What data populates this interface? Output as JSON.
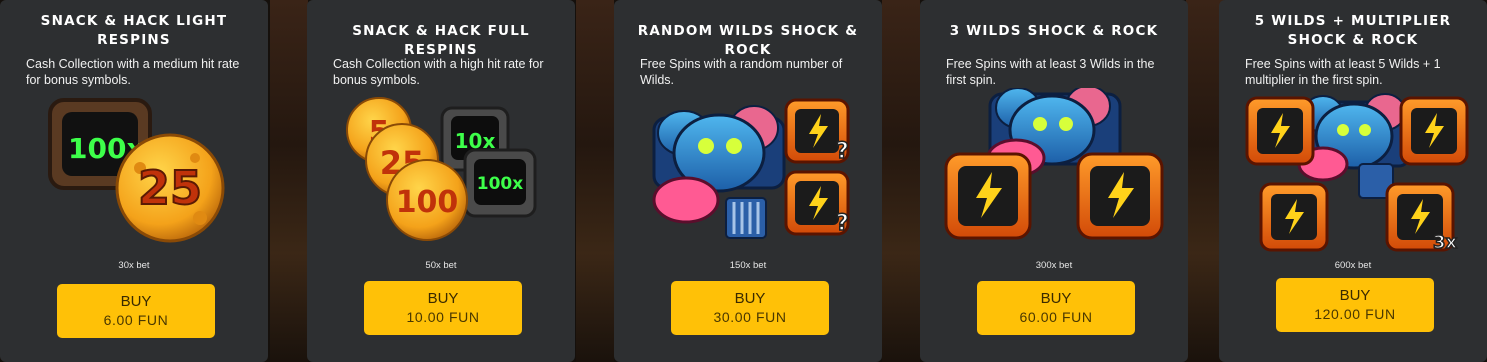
{
  "colors": {
    "card_bg": "#2d2f31",
    "button_bg": "#ffc107",
    "button_text": "#3a2a00"
  },
  "cards": [
    {
      "title": "Snack & Hack Light Respins",
      "description": "Cash Collection with a medium hit rate for bonus symbols.",
      "art_text": [
        "100x",
        "25"
      ],
      "bet": "30x bet",
      "buy_label": "BUY",
      "price": "6.00 FUN"
    },
    {
      "title": "Snack & Hack Full Respins",
      "description": "Cash Collection with a high hit rate for bonus symbols.",
      "art_text": [
        "5",
        "25",
        "100",
        "10x",
        "100x"
      ],
      "bet": "50x bet",
      "buy_label": "BUY",
      "price": "10.00 FUN"
    },
    {
      "title": "Random Wilds Shock & Rock",
      "description": "Free Spins with a random number of Wilds.",
      "art_text": [
        "?",
        "?"
      ],
      "bet": "150x bet",
      "buy_label": "BUY",
      "price": "30.00 FUN"
    },
    {
      "title": "3 Wilds Shock & Rock",
      "description": "Free Spins with at least 3 Wilds in the first spin.",
      "art_text": [],
      "bet": "300x bet",
      "buy_label": "BUY",
      "price": "60.00 FUN"
    },
    {
      "title": "5 Wilds + Multiplier Shock & Rock",
      "description": "Free Spins with at least 5 Wilds + 1 multiplier in the first spin.",
      "art_text": [
        "3x"
      ],
      "bet": "600x bet",
      "buy_label": "BUY",
      "price": "120.00 FUN"
    }
  ]
}
